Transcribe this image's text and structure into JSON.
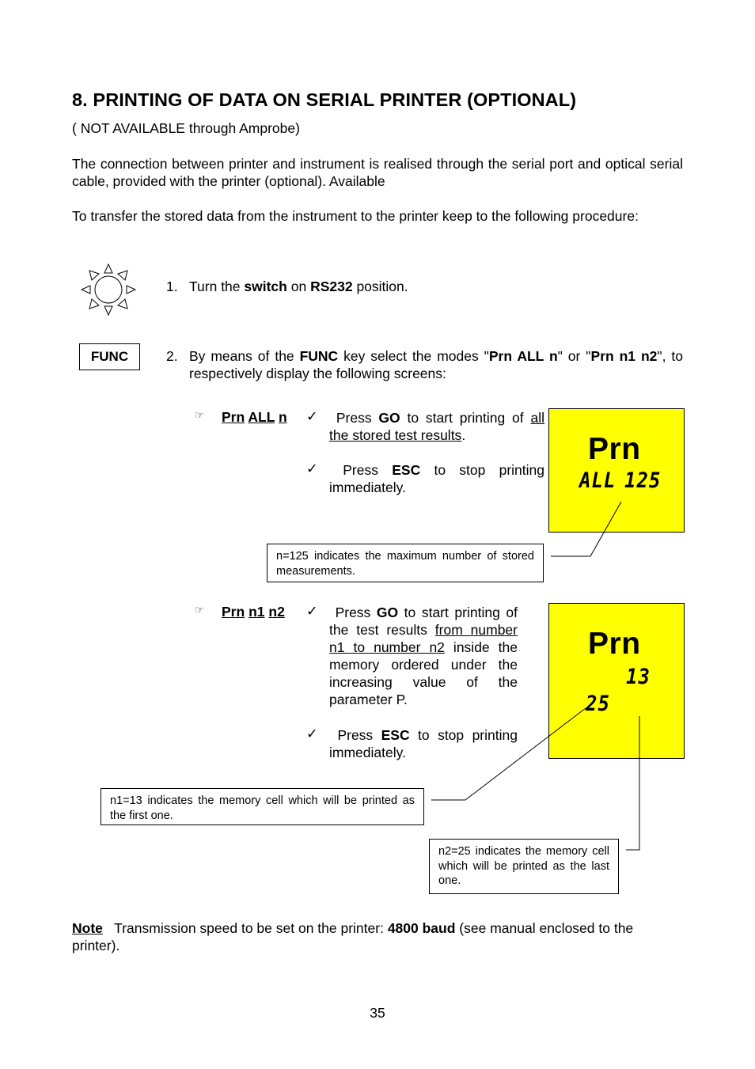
{
  "heading": "8. PRINTING OF DATA ON SERIAL PRINTER (OPTIONAL)",
  "subnote": "( NOT AVAILABLE through Amprobe)",
  "paragraphs": [
    "The connection between printer and instrument is realised through the serial port and optical serial cable, provided with the printer (optional). Available",
    "To transfer the stored data from the instrument to the printer keep to the following procedure:"
  ],
  "icons": {
    "rotary_switch": "rotary-switch-icon",
    "pointing_hand": "☞",
    "checkmark": "✓"
  },
  "steps": [
    {
      "number": "1.",
      "parts": [
        "Turn the ",
        "switch",
        " on ",
        "RS232",
        " position."
      ]
    },
    {
      "number": "2.",
      "key_label": "FUNC",
      "parts": [
        "By means of the ",
        "FUNC",
        " key select the modes \"",
        "Prn ALL n",
        "\" or \"",
        "Prn n1 n2",
        "\", to respectively display the following screens:"
      ]
    }
  ],
  "modes": [
    {
      "label_parts": [
        "Prn",
        "ALL",
        "n"
      ],
      "bullets": [
        {
          "pre": "Press ",
          "key": "GO",
          "mid": " to start printing of ",
          "underlined": "all the stored test results",
          "post": "."
        },
        {
          "pre": "Press ",
          "key": "ESC",
          "mid": " to stop printing immediately.",
          "underlined": "",
          "post": ""
        }
      ],
      "display": {
        "main": "Prn",
        "line2": "ALL",
        "line2b": "125",
        "background": "#ffff00"
      },
      "callout": "n=125 indicates the maximum number of stored measurements."
    },
    {
      "label_parts": [
        "Prn",
        "n1",
        "n2"
      ],
      "bullets": [
        {
          "pre": "Press ",
          "key": "GO",
          "mid": " to start printing of the test results ",
          "underlined": "from number n1 to number n2",
          "post": " inside the memory ordered under the increasing value of the parameter P."
        },
        {
          "pre": "Press ",
          "key": "ESC",
          "mid": " to stop printing immediately.",
          "underlined": "",
          "post": ""
        }
      ],
      "display": {
        "main": "Prn",
        "n1": "13",
        "n2": "25",
        "background": "#ffff00"
      },
      "callouts": [
        "n1=13 indicates the memory cell which will be printed as the first one.",
        "n2=25 indicates the memory cell which will be printed as the last one."
      ]
    }
  ],
  "note": {
    "label": "Note",
    "pre": "Transmission speed to be set on the printer: ",
    "bold": "4800 baud",
    "post": " (see manual enclosed to the printer)."
  },
  "page_number": "35"
}
